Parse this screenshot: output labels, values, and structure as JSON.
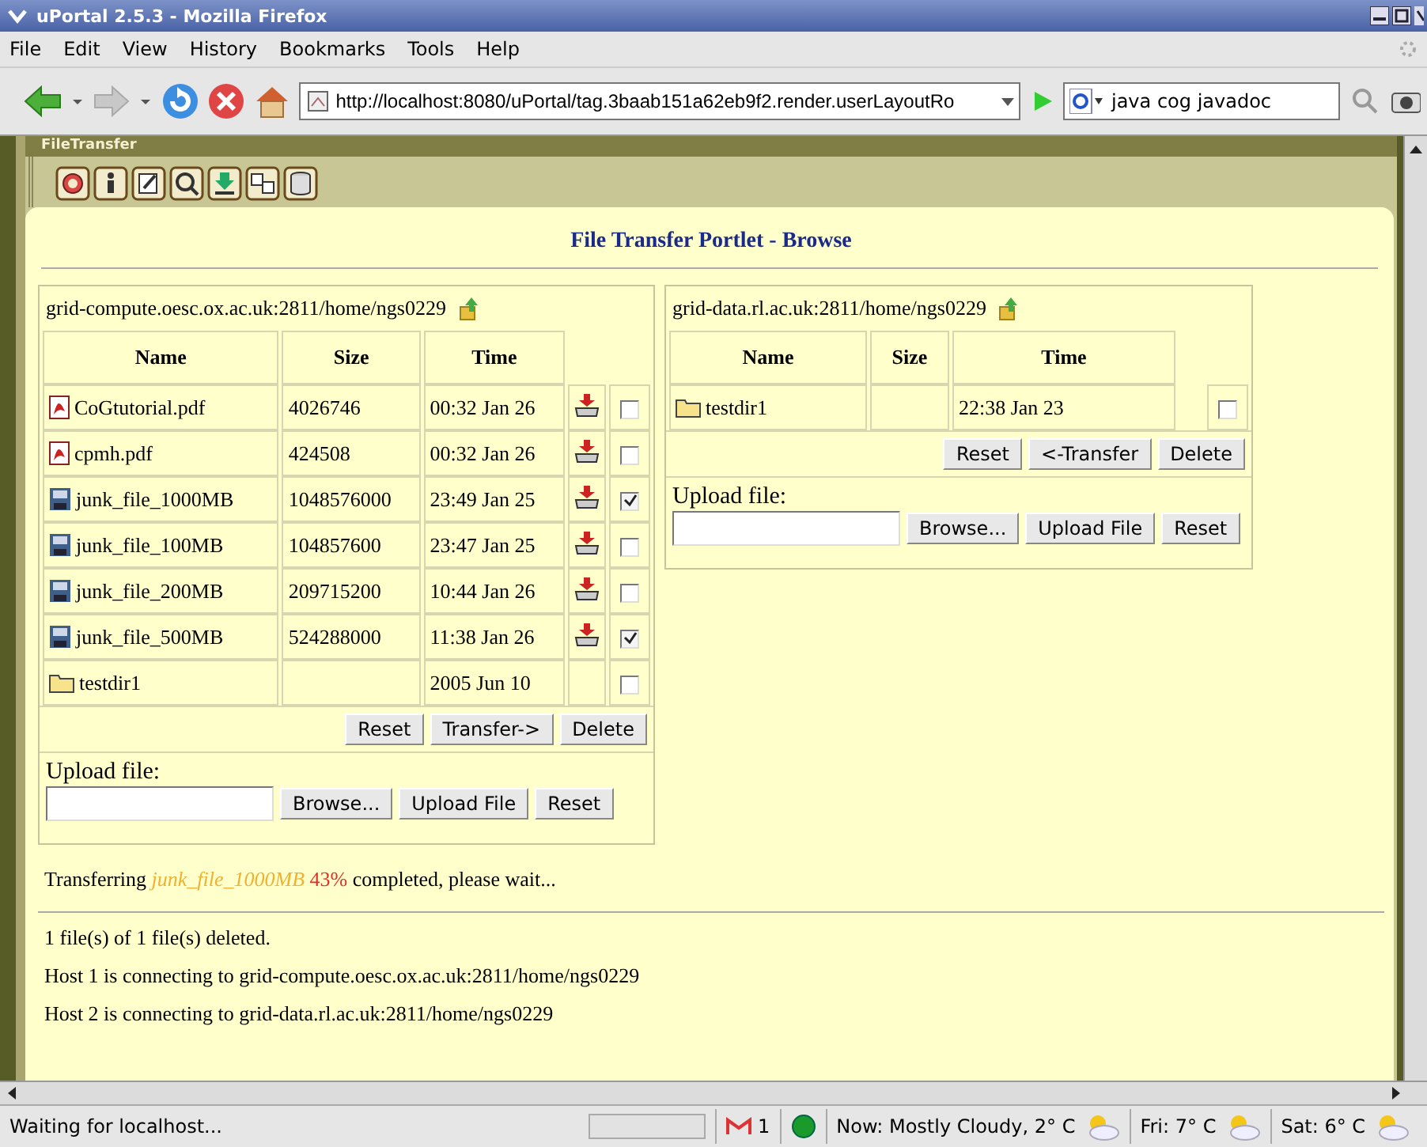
{
  "window": {
    "title": "uPortal 2.5.3 - Mozilla Firefox"
  },
  "menu": [
    "File",
    "Edit",
    "View",
    "History",
    "Bookmarks",
    "Tools",
    "Help"
  ],
  "navigation": {
    "url": "http://localhost:8080/uPortal/tag.3baab151a62eb9f2.render.userLayoutRo",
    "search": "java cog javadoc"
  },
  "portlet": {
    "title": "FileTransfer",
    "heading": "File Transfer Portlet - Browse"
  },
  "panes": [
    {
      "host": "grid-compute.oesc.ox.ac.uk:2811/home/ngs0229",
      "columns": [
        "Name",
        "Size",
        "Time"
      ],
      "rows": [
        {
          "kind": "pdf",
          "name": "CoGtutorial.pdf",
          "size": "4026746",
          "time": "00:32 Jan 26",
          "download": true,
          "checked": false
        },
        {
          "kind": "pdf",
          "name": "cpmh.pdf",
          "size": "424508",
          "time": "00:32 Jan 26",
          "download": true,
          "checked": false
        },
        {
          "kind": "file",
          "name": "junk_file_1000MB",
          "size": "1048576000",
          "time": "23:49 Jan 25",
          "download": true,
          "checked": true
        },
        {
          "kind": "file",
          "name": "junk_file_100MB",
          "size": "104857600",
          "time": "23:47 Jan 25",
          "download": true,
          "checked": false
        },
        {
          "kind": "file",
          "name": "junk_file_200MB",
          "size": "209715200",
          "time": "10:44 Jan 26",
          "download": true,
          "checked": false
        },
        {
          "kind": "file",
          "name": "junk_file_500MB",
          "size": "524288000",
          "time": "11:38 Jan 26",
          "download": true,
          "checked": true
        },
        {
          "kind": "folder",
          "name": "testdir1",
          "time": "2005 Jun 10",
          "download": false,
          "checked": false
        }
      ],
      "buttons": [
        "Reset",
        "Transfer->",
        "Delete"
      ],
      "upload_label": "Upload file:",
      "upload_buttons": [
        "Browse...",
        "Upload File",
        "Reset"
      ]
    },
    {
      "host": "grid-data.rl.ac.uk:2811/home/ngs0229",
      "columns": [
        "Name",
        "Size",
        "Time"
      ],
      "rows": [
        {
          "kind": "folder",
          "name": "testdir1",
          "time": "22:38 Jan 23",
          "checked": false
        }
      ],
      "buttons": [
        "Reset",
        "<-Transfer",
        "Delete"
      ],
      "upload_label": "Upload file:",
      "upload_buttons": [
        "Browse...",
        "Upload File",
        "Reset"
      ]
    }
  ],
  "progress": {
    "prefix": "Transferring",
    "file": "junk_file_1000MB",
    "percent": "43%",
    "suffix": "completed, please wait..."
  },
  "messages": [
    "1 file(s) of 1 file(s) deleted.",
    "Host 1 is connecting to grid-compute.oesc.ox.ac.uk:2811/home/ngs0229",
    "Host 2 is connecting to grid-data.rl.ac.uk:2811/home/ngs0229"
  ],
  "status_bar": {
    "text": "Waiting for localhost...",
    "mail_count": "1",
    "weather": [
      "Now: Mostly Cloudy, 2° C",
      "Fri: 7° C",
      "Sat: 6° C"
    ]
  }
}
